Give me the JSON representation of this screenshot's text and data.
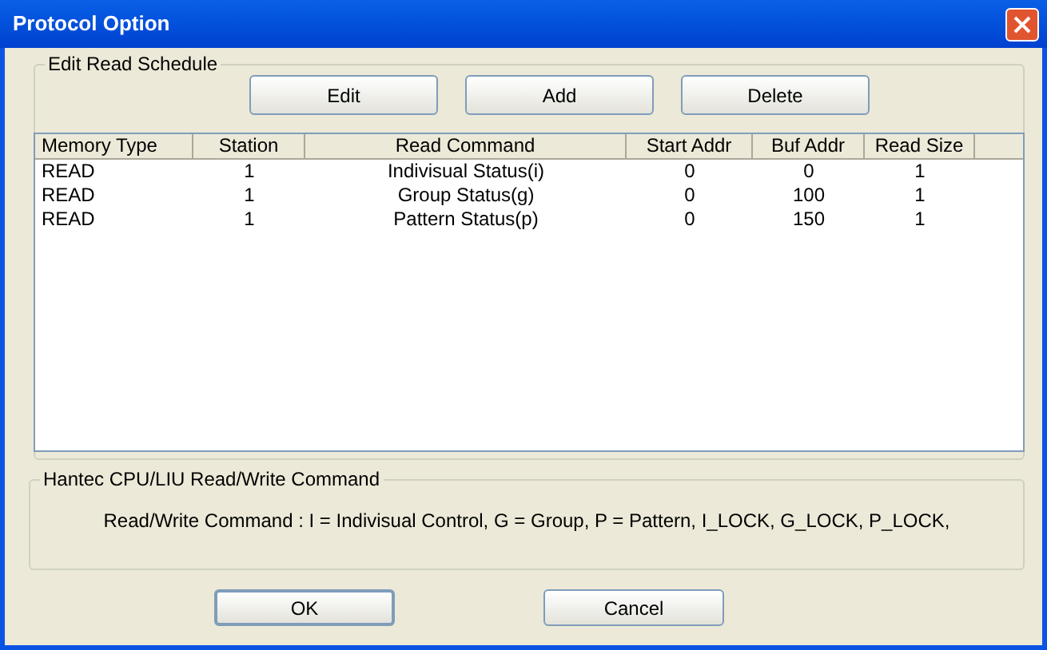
{
  "window": {
    "title": "Protocol Option"
  },
  "schedule": {
    "title": "Edit Read Schedule",
    "buttons": [
      "Edit",
      "Add",
      "Delete"
    ],
    "columns": [
      "Memory Type",
      "Station",
      "Read Command",
      "Start Addr",
      "Buf Addr",
      "Read Size"
    ],
    "rows": [
      [
        "READ",
        "1",
        "Indivisual Status(i)",
        "0",
        "0",
        "1"
      ],
      [
        "READ",
        "1",
        "Group Status(g)",
        "0",
        "100",
        "1"
      ],
      [
        "READ",
        "1",
        "Pattern Status(p)",
        "0",
        "150",
        "1"
      ]
    ]
  },
  "command_info": {
    "title": "Hantec CPU/LIU Read/Write Command",
    "text": "Read/Write Command : I = Indivisual Control, G = Group, P = Pattern, I_LOCK, G_LOCK, P_LOCK,"
  },
  "buttons": [
    {
      "label": "OK",
      "default": true
    },
    {
      "label": "Cancel",
      "default": false
    }
  ]
}
